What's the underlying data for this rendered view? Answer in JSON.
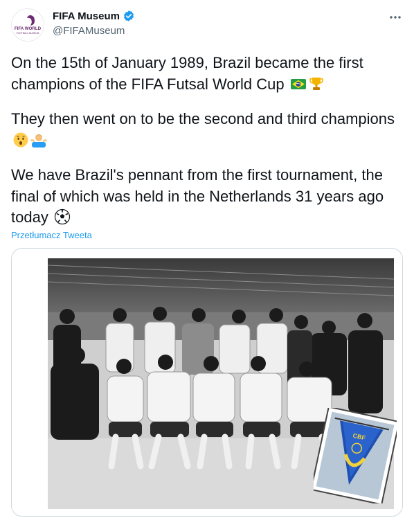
{
  "author": {
    "display_name": "FIFA Museum",
    "handle": "@FIFAMuseum",
    "avatar_text_line1": "FIFA WORLD",
    "avatar_text_line2": "FOOTBALL MUSEUM"
  },
  "tweet": {
    "paragraph1": "On the 15th of January 1989, Brazil became the first champions of the FIFA Futsal World Cup",
    "paragraph2": "They then went on to be the second and third champions",
    "paragraph3": "We have Brazil's pennant from the first tournament, the final of which was held in the Netherlands 31 years ago today",
    "translate_link": "Przetłumacz Tweeta"
  },
  "icons": {
    "verified": "verified-badge-icon",
    "more": "more-options-icon",
    "emoji1": "brazil-flag-emoji",
    "emoji2": "trophy-emoji",
    "emoji3": "hushed-face-emoji",
    "emoji4": "man-shrugging-emoji",
    "emoji5": "soccer-ball-emoji"
  },
  "media": {
    "pennant_label": "CBF"
  },
  "colors": {
    "verified_blue": "#1d9bf0",
    "text_primary": "#0f1419",
    "text_secondary": "#536471",
    "border": "#cfd9de"
  }
}
